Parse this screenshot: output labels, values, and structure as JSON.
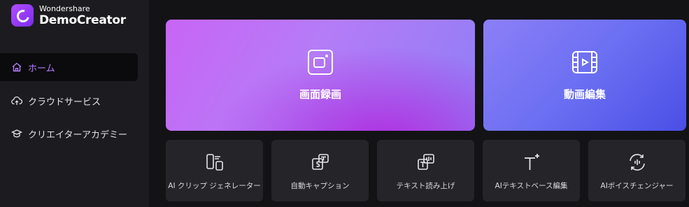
{
  "app": {
    "brand_small": "Wondershare",
    "brand_name": "DemoCreator",
    "accent": "#b57cff"
  },
  "sidebar": {
    "items": [
      {
        "label": "ホーム",
        "icon": "home-icon",
        "active": true
      },
      {
        "label": "クラウドサービス",
        "icon": "cloud-upload-icon",
        "active": false
      },
      {
        "label": "クリエイターアカデミー",
        "icon": "graduation-cap-icon",
        "active": false
      }
    ]
  },
  "main": {
    "cards": [
      {
        "label": "画面録画",
        "icon": "screen-record-icon"
      },
      {
        "label": "動画編集",
        "icon": "video-edit-icon"
      }
    ],
    "tools": [
      {
        "label": "AI クリップ ジェネレーター",
        "icon": "ai-clip-icon"
      },
      {
        "label": "自動キャプション",
        "icon": "auto-caption-icon"
      },
      {
        "label": "テキスト読み上げ",
        "icon": "text-to-speech-icon"
      },
      {
        "label": "AIテキストベース編集",
        "icon": "ai-text-edit-icon"
      },
      {
        "label": "AIボイスチェンジャー",
        "icon": "ai-voice-changer-icon"
      }
    ]
  }
}
